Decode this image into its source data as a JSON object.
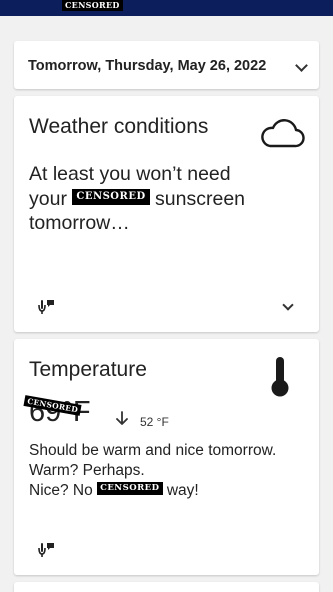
{
  "header": {
    "censor_label": "CENSORED"
  },
  "date_selector": {
    "label": "Tomorrow, Thursday, May 26, 2022"
  },
  "weather": {
    "title": "Weather conditions",
    "line1": "At least you won’t need",
    "line2_before": "your",
    "censor_label": "CENSORED",
    "line2_after": "sunscreen",
    "line3": "tomorrow…",
    "icon": "cloud-icon"
  },
  "temperature": {
    "title": "Temperature",
    "value_hidden": "69",
    "unit": "°F",
    "censor_label": "CENSORED",
    "low": "52 °F",
    "line1": "Should be warm and nice tomorrow.",
    "line2": "Warm? Perhaps.",
    "line3_before": "Nice? No",
    "line3_censor": "CENSORED",
    "line3_after": "way!",
    "icon": "thermometer-icon"
  },
  "colors": {
    "header": "#0c1f5c",
    "card": "#ffffff",
    "background": "#f1f1f1"
  }
}
